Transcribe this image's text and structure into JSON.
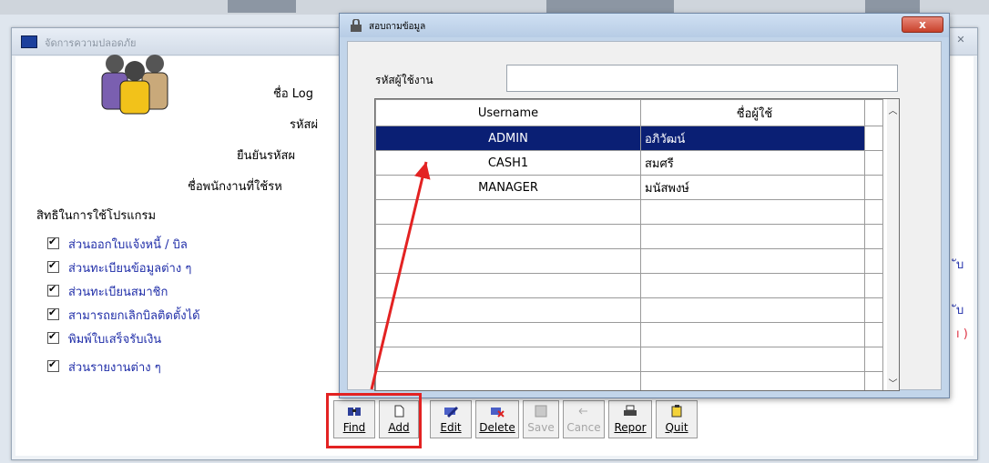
{
  "main_window": {
    "title": "จัดการความปลอดภัย",
    "labels": {
      "login": "ชื่อ Log",
      "password": "รหัสผ่",
      "confirm": "ยืนยันรหัสผ",
      "employee": "ชื่อพนักงานที่ใช้รห"
    },
    "rights_title": "สิทธิในการใช้โปรแกรม",
    "rights": [
      "ส่วนออกใบแจ้งหนี้ / บิล",
      "ส่วนทะเบียนข้อมูลต่าง ๆ",
      "ส่วนทะเบียนสมาชิก",
      "สามารถยกเลิกบิลติดตั้งได้",
      "พิมพ์ใบเสร็จรับเงิน",
      "ส่วนรายงานต่าง ๆ"
    ],
    "right_fragments": [
      "ับ",
      "ับ",
      "ı )"
    ]
  },
  "toolbar": {
    "buttons": [
      {
        "label": "Find",
        "enabled": true
      },
      {
        "label": "Add",
        "enabled": true
      },
      {
        "label": "Edit",
        "enabled": true
      },
      {
        "label": "Delete",
        "enabled": true
      },
      {
        "label": "Save",
        "enabled": false
      },
      {
        "label": "Cance",
        "enabled": false
      },
      {
        "label": "Repor",
        "enabled": true
      },
      {
        "label": "Quit",
        "enabled": true
      }
    ]
  },
  "dialog": {
    "title": "สอบถามข้อมูล",
    "close_label": "x",
    "uid_label": "รหัสผู้ใช้งาน",
    "uid_value": "",
    "columns": [
      "Username",
      "ชื่อผู้ใช้"
    ],
    "rows": [
      {
        "username": "ADMIN",
        "name": "อภิวัฒน์",
        "selected": true
      },
      {
        "username": "CASH1",
        "name": "สมศรี",
        "selected": false
      },
      {
        "username": "MANAGER",
        "name": "มนัสพงษ์",
        "selected": false
      }
    ],
    "empty_rows": 8
  },
  "colors": {
    "selection": "#0a1f74",
    "annotation_red": "#e32222",
    "link_blue": "#1f2da8"
  }
}
